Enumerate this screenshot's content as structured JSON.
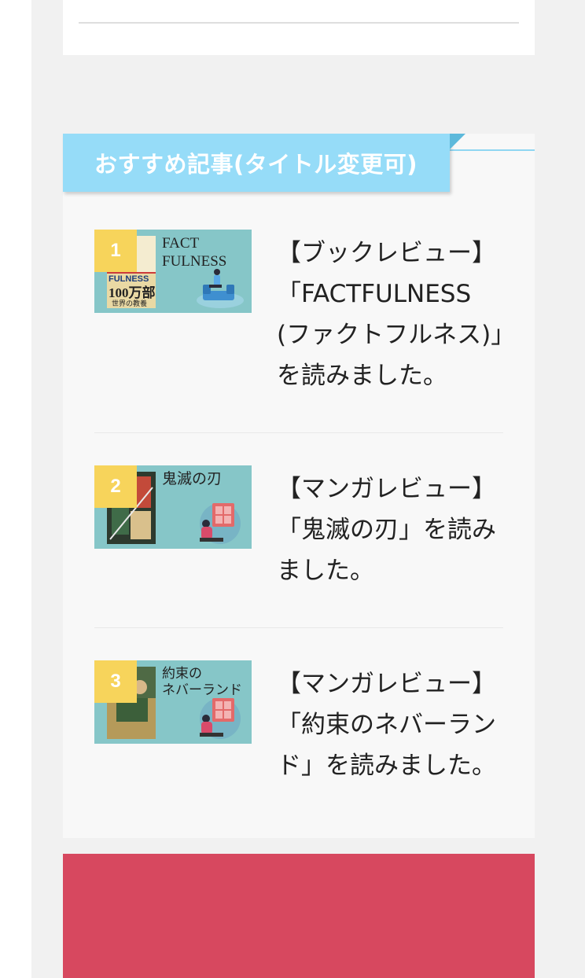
{
  "widget": {
    "title": "おすすめ記事(タイトル変更可)"
  },
  "articles": [
    {
      "rank": "1",
      "thumb_text": "FACT\nFULNESS",
      "cover_text": "FULNESS\n100万部\n世界の教養",
      "title": "【ブックレビュー】「FACTFULNESS(ファクトフルネス)」を読みました。"
    },
    {
      "rank": "2",
      "thumb_text": "鬼滅の刃",
      "title": "【マンガレビュー】「鬼滅の刃」を読みました。"
    },
    {
      "rank": "3",
      "thumb_text": "約束の\nネバーランド",
      "title": "【マンガレビュー】「約束のネバーランド」を読みました。"
    }
  ],
  "colors": {
    "widget_title_bg": "#96dcf8",
    "rank_badge": "#f7d45b",
    "thumb_bg": "#86c6c8",
    "footer_block": "#d7485f"
  }
}
